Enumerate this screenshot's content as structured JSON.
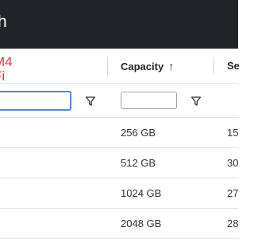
{
  "app": {
    "title_fragment": "h"
  },
  "grid": {
    "columns": {
      "product": {
        "header": "M4\nFi"
      },
      "capacity": {
        "header": "Capacity",
        "sort_arrow": "↑"
      },
      "speed": {
        "header": "Se"
      }
    },
    "filters": {
      "product": {
        "value": ""
      },
      "capacity": {
        "value": ""
      }
    },
    "rows": [
      {
        "capacity": "256 GB",
        "speed": "15"
      },
      {
        "capacity": "512 GB",
        "speed": "30"
      },
      {
        "capacity": "1024 GB",
        "speed": "27"
      },
      {
        "capacity": "2048 GB",
        "speed": "28"
      }
    ]
  },
  "icons": {
    "filter": "filter-icon",
    "sort": "sort-ascending-icon"
  }
}
